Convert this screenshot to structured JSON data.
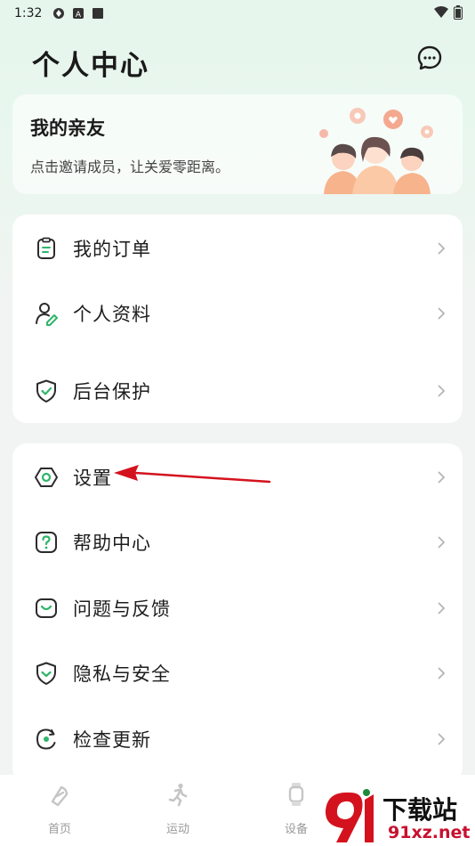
{
  "status_bar": {
    "time": "1:32"
  },
  "header": {
    "title": "个人中心",
    "message_icon": "chat-bubble-icon"
  },
  "friends_card": {
    "title": "我的亲友",
    "subtitle": "点击邀请成员，让关爱零距离。"
  },
  "menu_group1": [
    {
      "label": "我的订单",
      "icon": "order-clipboard-icon"
    },
    {
      "label": "个人资料",
      "icon": "profile-person-icon"
    },
    {
      "label": "后台保护",
      "icon": "shield-check-icon"
    }
  ],
  "menu_group2": [
    {
      "label": "设置",
      "icon": "settings-hexagon-icon"
    },
    {
      "label": "帮助中心",
      "icon": "help-question-icon"
    },
    {
      "label": "问题与反馈",
      "icon": "feedback-icon"
    },
    {
      "label": "隐私与安全",
      "icon": "privacy-shield-icon"
    },
    {
      "label": "检查更新",
      "icon": "update-refresh-icon"
    }
  ],
  "tabbar": [
    {
      "label": "首页",
      "icon": "home-icon"
    },
    {
      "label": "运动",
      "icon": "running-icon"
    },
    {
      "label": "设备",
      "icon": "watch-icon"
    }
  ],
  "watermark": {
    "line1": "下载站",
    "line2": "91xz.net"
  },
  "colors": {
    "accent": "#2fb56a",
    "icon": "#2b2b2b",
    "annotation_arrow": "#d4121d"
  }
}
